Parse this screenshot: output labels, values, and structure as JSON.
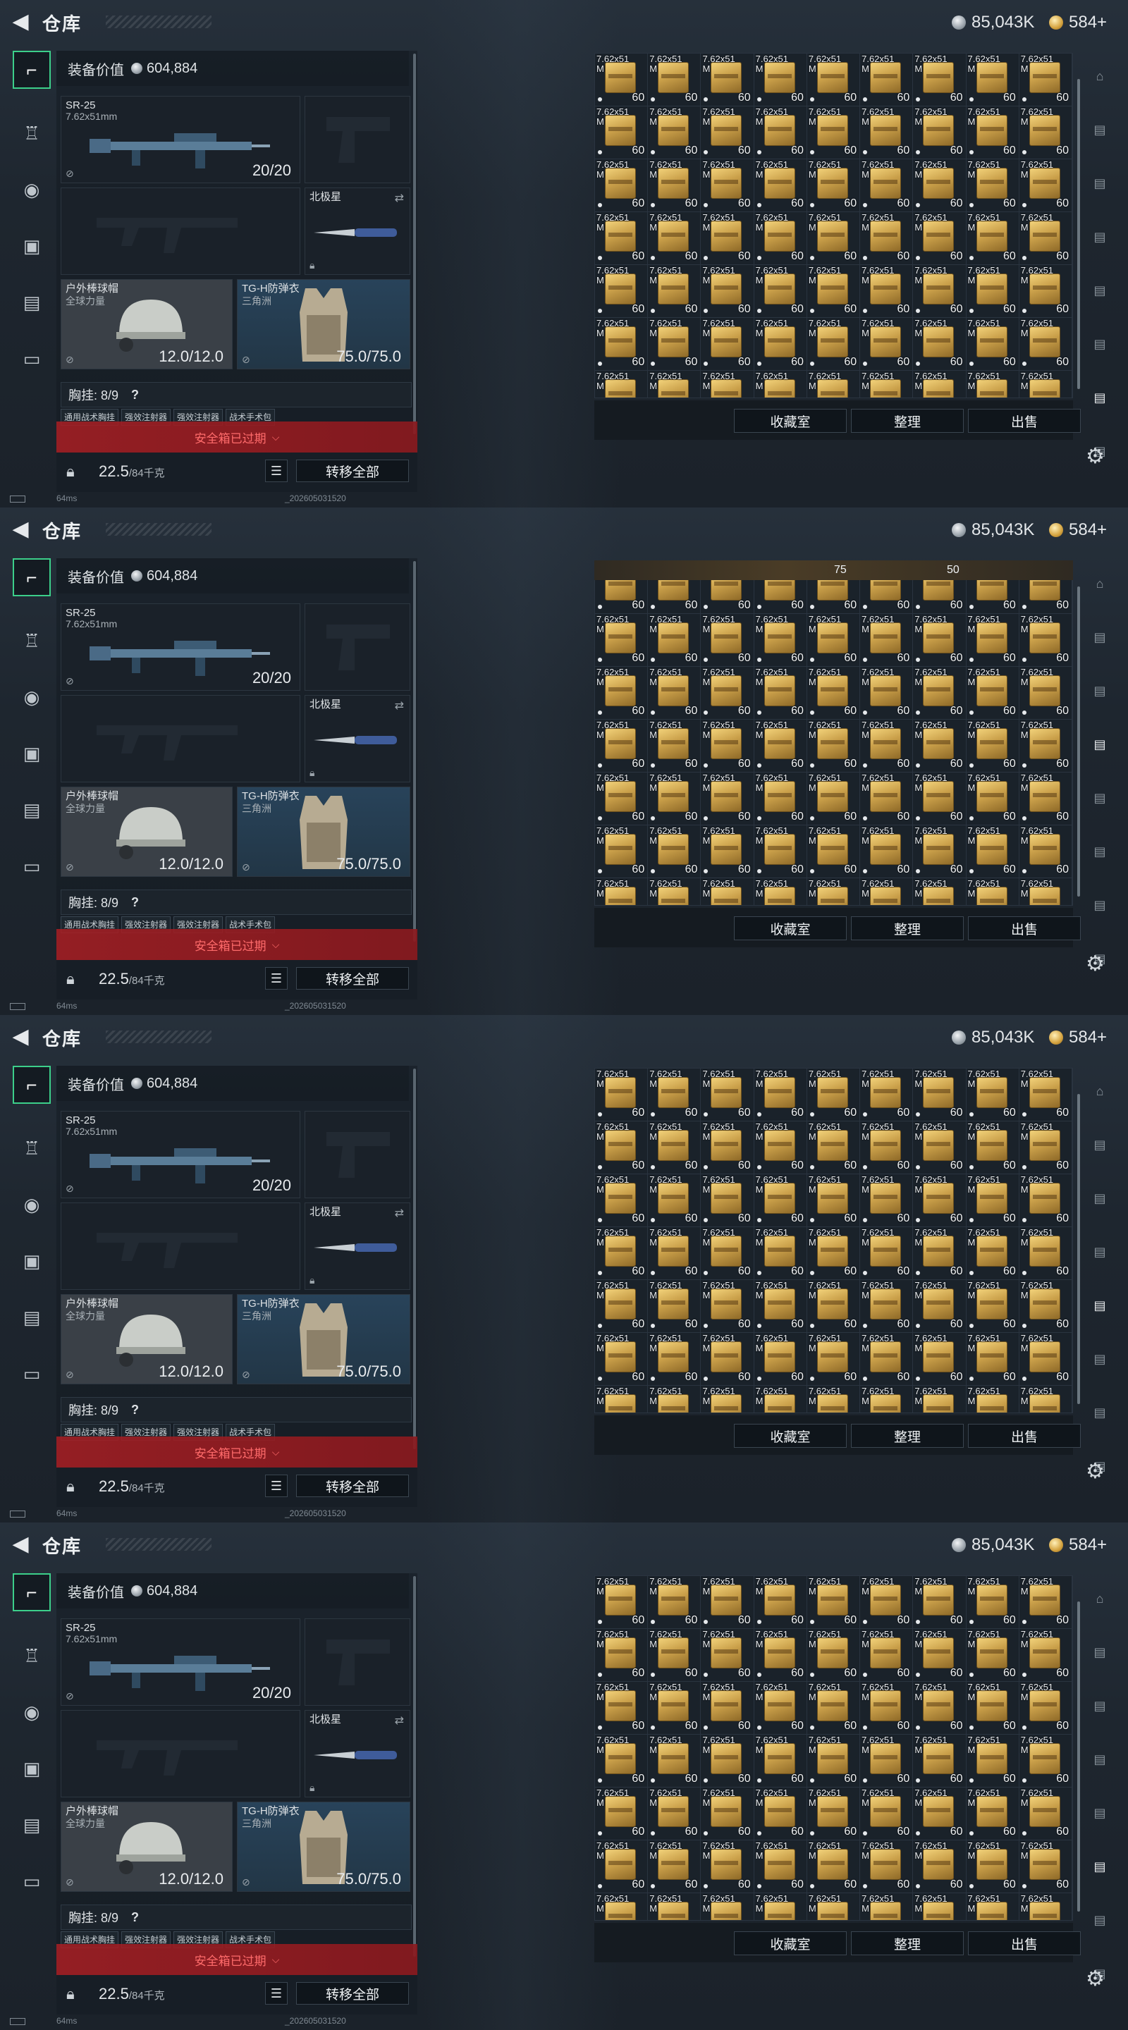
{
  "frames_count": 4,
  "header": {
    "title": "仓库",
    "silver_amount": "85,043K",
    "gold_amount": "584+"
  },
  "sidebar": {
    "tabs": [
      {
        "icon": "pistol-icon",
        "active": true
      },
      {
        "icon": "armor-icon",
        "active": false
      },
      {
        "icon": "helmet-icon",
        "active": false
      },
      {
        "icon": "backpack-icon",
        "active": false
      },
      {
        "icon": "clipboard-icon",
        "active": false
      },
      {
        "icon": "briefcase-icon",
        "active": false
      }
    ]
  },
  "loadout": {
    "value_label": "装备价值",
    "value": "604,884",
    "primary": {
      "name": "SR-25",
      "caliber": "7.62x51mm",
      "count": "20/20"
    },
    "melee": {
      "name": "北极星"
    },
    "helmet": {
      "name": "户外棒球帽",
      "sub": "全球力量",
      "durability": "12.0/12.0"
    },
    "armor": {
      "name": "TG-H防弹衣",
      "sub": "三角洲",
      "durability": "75.0/75.0"
    },
    "vest_label": "胸挂: 8/9",
    "vest_help": "?",
    "chips": [
      "通用战术胸挂",
      "强效注射器",
      "强效注射器",
      "战术手术包"
    ],
    "safebox_expired": "安全箱已过期",
    "weight": "22.5",
    "weight_max": "/84千克",
    "transfer_all": "转移全部"
  },
  "status": {
    "ping": "64ms",
    "build": "_202605031520"
  },
  "stash": {
    "item_label_line1": "7.62x51",
    "item_label_line2": "M",
    "item_count": "60",
    "overlay_values": [
      "75",
      "50"
    ]
  },
  "actions": {
    "collection": "收藏室",
    "organize": "整理",
    "sell": "出售"
  },
  "right_rail": {
    "icons": [
      "case-icon",
      "tv-case-icon",
      "tv-case-icon",
      "tv-case-icon",
      "tv-case-icon",
      "tv-case-icon",
      "tv-case-icon",
      "tv-case-icon"
    ]
  }
}
